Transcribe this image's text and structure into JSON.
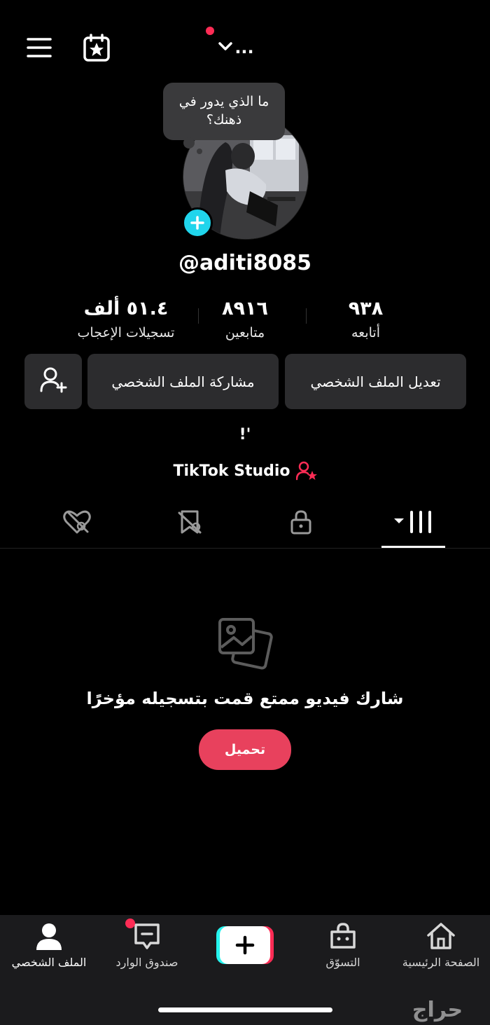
{
  "header": {
    "menu_icon": "hamburger-menu-icon",
    "calendar_icon": "calendar-star-icon",
    "account_switch_label": "...",
    "account_switch_icon": "chevron-down-icon"
  },
  "profile": {
    "note_bubble": "ما الذي يدور في ذهنك؟",
    "username": "@aditi8085",
    "stats": [
      {
        "value": "٥١.٤ ألف",
        "label": "تسجيلات الإعجاب"
      },
      {
        "value": "٨٩١٦",
        "label": "متابعين"
      },
      {
        "value": "٩٣٨",
        "label": "أتابعه"
      }
    ],
    "buttons": {
      "share": "مشاركة الملف الشخصي",
      "edit": "تعديل الملف الشخصي"
    },
    "bio": "!'",
    "studio_label": "TikTok Studio"
  },
  "tabs": [
    {
      "icon": "liked-heart-icon"
    },
    {
      "icon": "saved-bookmark-icon"
    },
    {
      "icon": "lock-icon"
    },
    {
      "icon": "videos-grid-icon"
    }
  ],
  "empty_state": {
    "icon": "photos-icon",
    "message": "شارك فيديو ممتع قمت بتسجيله مؤخرًا",
    "upload_label": "تحميل"
  },
  "bottom_nav": [
    {
      "label": "الملف الشخصي",
      "icon": "profile-icon"
    },
    {
      "label": "صندوق الوارد",
      "icon": "inbox-icon"
    },
    {
      "label": "",
      "icon": "create-plus-icon"
    },
    {
      "label": "التسوّق",
      "icon": "shop-bag-icon"
    },
    {
      "label": "الصفحة الرئيسية",
      "icon": "home-icon"
    }
  ],
  "watermark": "حراج",
  "colors": {
    "accent": "#fe2c55",
    "upload": "#e8415d",
    "badge": "#20d5ec"
  }
}
